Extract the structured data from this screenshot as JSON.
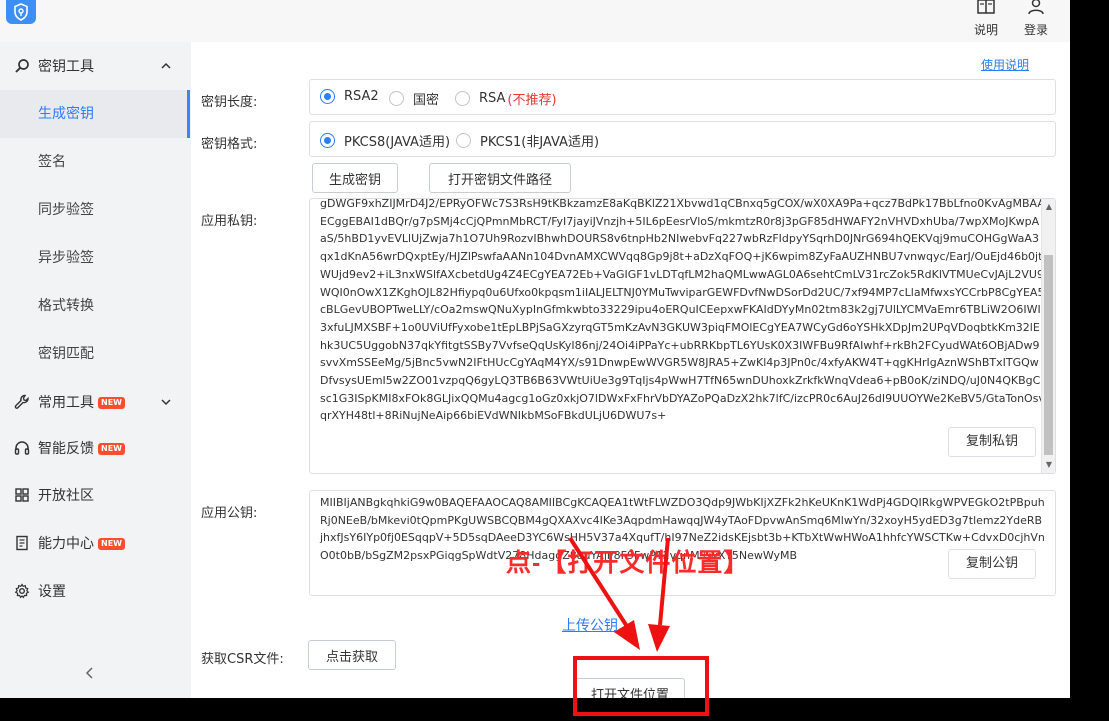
{
  "header": {
    "help_button_label": "说明",
    "login_button_label": "登录"
  },
  "sidebar": {
    "key_tools_label": "密钥工具",
    "key_tool_items": [
      {
        "label": "生成密钥"
      },
      {
        "label": "签名"
      },
      {
        "label": "同步验签"
      },
      {
        "label": "异步验签"
      },
      {
        "label": "格式转换"
      },
      {
        "label": "密钥匹配"
      }
    ],
    "common_tools_label": "常用工具",
    "smart_feedback_label": "智能反馈",
    "open_community_label": "开放社区",
    "capability_center_label": "能力中心",
    "settings_label": "设置",
    "new_badge": "NEW"
  },
  "main": {
    "help_link": "使用说明",
    "key_length": {
      "label": "密钥长度:",
      "options": [
        "RSA2",
        "国密",
        "RSA"
      ],
      "selected": "RSA2",
      "rsa_warning": "(不推荐)"
    },
    "key_format": {
      "label": "密钥格式:",
      "options": [
        "PKCS8(JAVA适用)",
        "PKCS1(非JAVA适用)"
      ],
      "selected": "PKCS8(JAVA适用)"
    },
    "generate_button": "生成密钥",
    "open_path_button": "打开密钥文件路径",
    "private_key": {
      "label": "应用私钥:",
      "value": "gDWGF9xhZIJMrD4J2/EPRyOFWc7S3RsH9tKBkzamzE8aKqBKlZ21Xbvwd1qCBnxq5gCOX/wX0XA9Pa+qcz7BdPk17BbLfno0KvAgMBAAECggEBAI1dBQr/g7pSMj4cCjQPmnMbRCT/FyI7jayiJVnzjh+5IL6pEesrVloS/mkmtzR0r8j3pGF85dHWAFY2nVHVDxhUba/7wpXMoJKwpAaS/5hBD1yvEVLlUjZwja7h1O7Uh9RozvIBhwhDOURS8v6tnpHb2NIwebvFq227wbRzFIdpyYSqrhD0JNrG694hQEKVqj9muCOHGgWaA3qx1dKnA56wrDQxptEy/HJZlPswfaAANn104DvnAMXCWVqq8Gp9j8t+aDzXqFOQ+jK6wpim8ZyFaAUZHNBU7vnwqyc/EarJ/OuEjd46b0jtWUjd9ev2+iL3nxWSlfAXcbetdUg4Z4ECgYEA72Eb+VaGIGF1vLDTqfLM2haQMLwwAGL0A6sehtCmLV31rcZok5RdKlVTMUeCvJAjL2VU9WQI0nOwX1ZKghOJL82Hfiypq0u6Ufxo0kpqsm1iIALJELTNJ0YMuTwviparGEWFDvfNwDSorDd2UC/7xf94MP7cLlaMfwxsYCCrbP8CgYEA5cBLGevUBOPTweLLY/cOa2mswQNuXypInGfmkwbto33229ipu4oERQuICEepxwFKAIdDYyMn02tm83k2gj7UlLYCMVaEmr6TBLiW2O6IWI3xfuLJMXSBF+1o0UViUfFyxobe1tEpLBPjSaGXzyrqGT5mKzAvN3GKUW3piqFMOlECgYEA7WCyGd6oYSHkXDpJm2UPqVDoqbtkKm32lEhk3UC5UggobN37qkYfitgtSSBy7VvfseQqUsKyI86nj/24Oi4iPPaYc+ubRRKbpTL6YUsK0X3IWFBu9RfAIwhf+rkBh2FCyudWAt6OBjADw9svvXmSSEeMg/5jBnc5vwN2IFtHUcCgYAqM4YX/s91DnwpEwWVGR5W8JRA5+ZwKl4p3JPn0c/4xfyAKW4T+qgKHrIgAznWShBTxITGQwDfvsysUEmI5w2ZO01vzpqQ6gyLQ3TB6B63VWtUiUe3g9TqIjs4pWwH7TfN65wnDUhoxkZrkfkWnqVdea6+pB0oK/ziNDQ/uJ0N4QKBgCsc1G3ISpKMI8xFOk8GLJixQQMu4agcg1oGz0xkjO7lDWxFxFhrVbDYAZoPQaDzX2hk7lfC/izcPR0c6AuJ26dI9UUOYWe2KeBV5/GtaTonOsvqrXYH48tl+8RiNujNeAip66biEVdWNIkbMSoFBkdULjU6DWU7s+"
    },
    "copy_private_button": "复制私钥",
    "public_key": {
      "label": "应用公钥:",
      "value": "MIIBIjANBgkqhkiG9w0BAQEFAAOCAQ8AMIIBCgKCAQEA1tWtFLWZDO3Qdp9JWbKIjXZFk2hKeUKnK1WdPj4GDQIRkgWPVEGkO2tPBpuhRj0NEeB/bMkevi0tQpmPKgUWSBCQBM4gQXAXvc4IKe3AqpdmHawqqJW4yTAoFDpvwAnSmq6MlwYn/32xoyH5ydED3g7tlemz2YdeRBjhxfJsY6IYp0fj0ESqqpV+5D5sqDAeeD3YC6WsHH5V37a4XqufT/hI97NeZ2idsKEjsbt3b+KTbXtWwHWoA1hhfcYWSCTKw+CdvxD0cjhVnO0t0bB/bSgZM2psxPGiqgSpWdtV278HdaggZ8auYAjl/8F9FwPT2vqnM+wXT5NewWyMB"
    },
    "copy_public_button": "复制公钥",
    "upload_link": "上传公钥",
    "csr": {
      "label": "获取CSR文件:",
      "button": "点击获取"
    },
    "open_file_location_button": "打开文件位置"
  },
  "annotation": {
    "text": "点-【打开文件位置】",
    "color": "#ff2a2a"
  }
}
